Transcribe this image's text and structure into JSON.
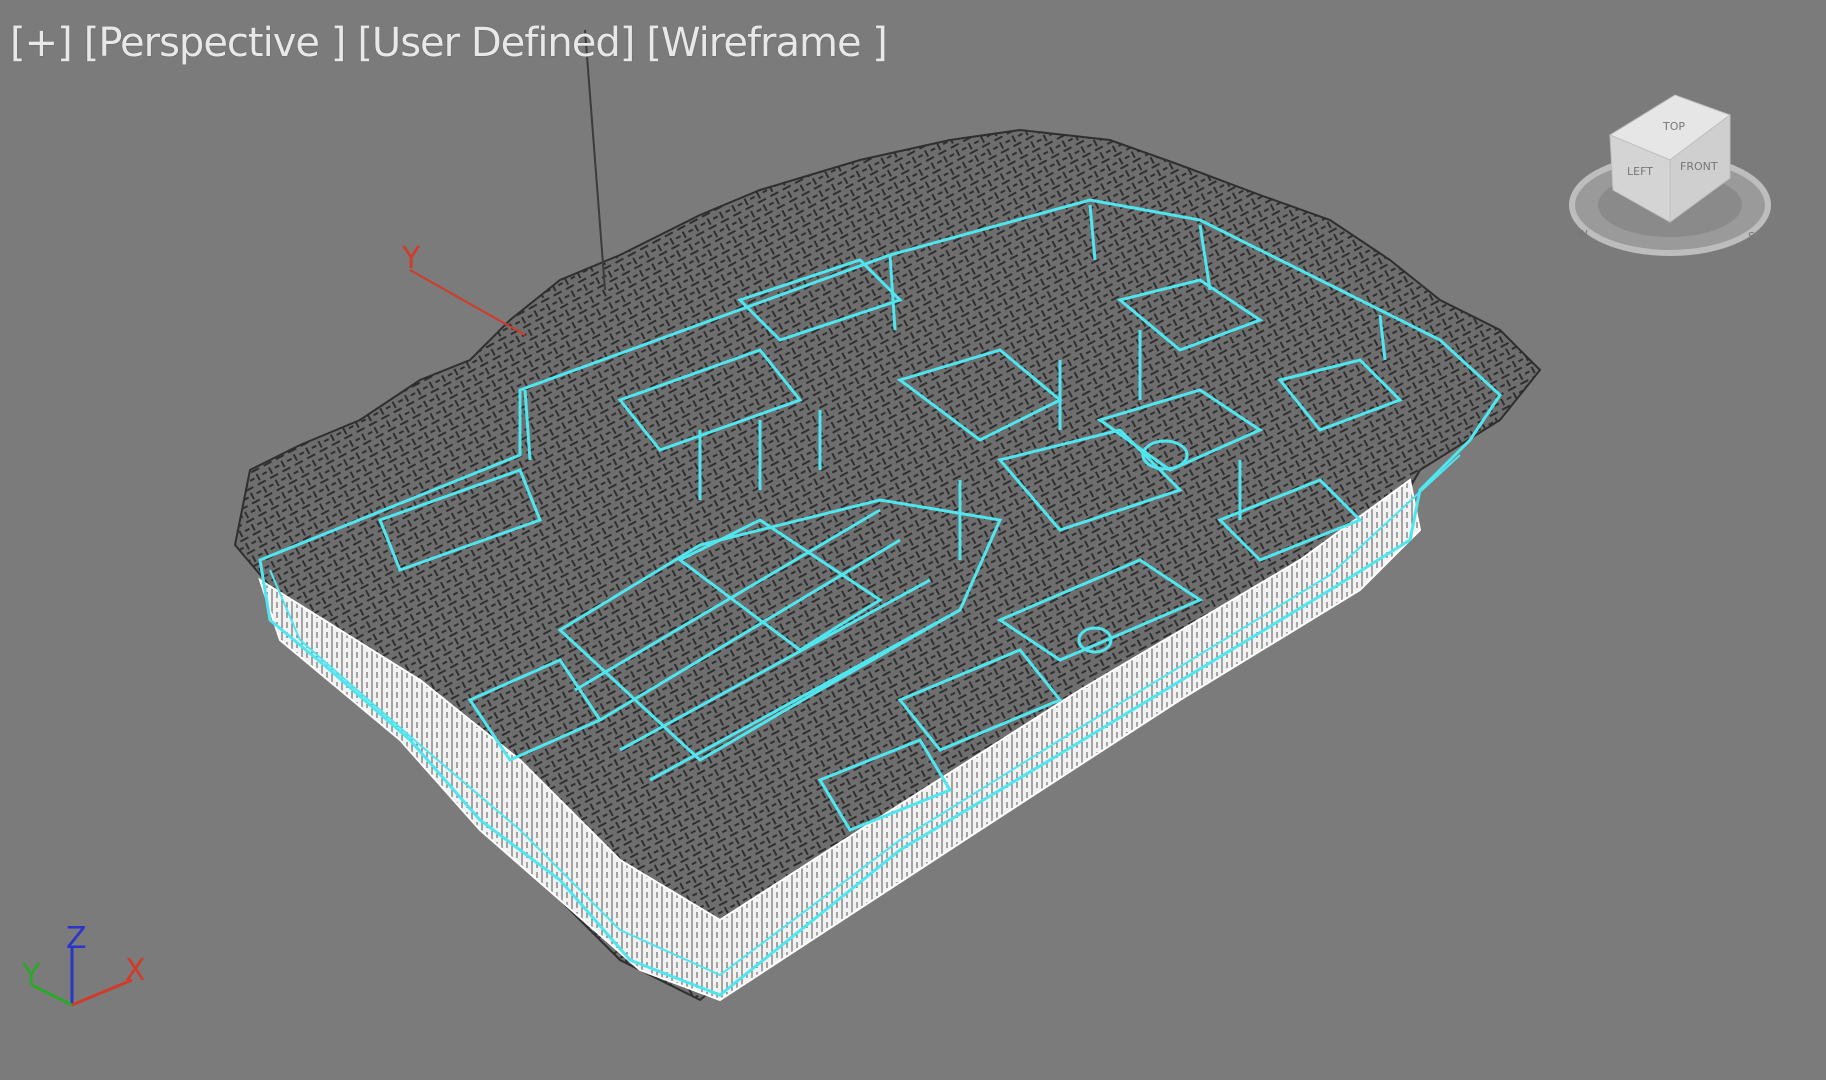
{
  "viewport": {
    "labels": [
      "[+]",
      "[Perspective ]",
      "[User Defined]",
      "[Wireframe ]"
    ]
  },
  "viewcube": {
    "top_face": "TOP",
    "left_face": "LEFT",
    "front_face": "FRONT",
    "ring_w": "W",
    "ring_s": "S"
  },
  "gizmo": {
    "y_axis": "Y",
    "z_label": "Z",
    "y_label": "Y",
    "x_label": "X"
  },
  "colors": {
    "viewport_bg": "#7b7b7b",
    "selection_wire": "#4fe6f0",
    "mesh_dark": "#3a3a3a",
    "mesh_light": "#ffffff",
    "axis_x": "#d23a2a",
    "axis_y": "#2aa82a",
    "axis_z": "#2a36c8"
  }
}
